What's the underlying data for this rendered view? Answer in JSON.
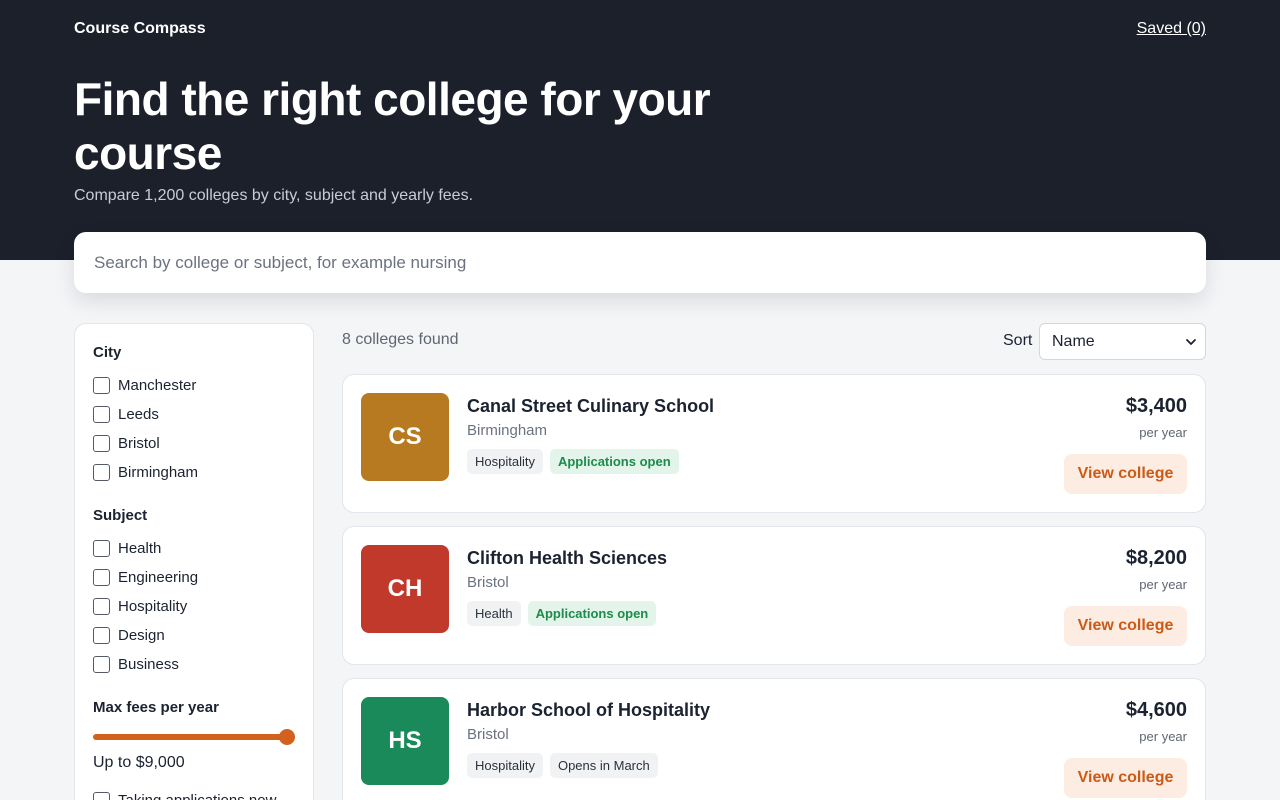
{
  "header": {
    "brand": "Course Compass",
    "saved_link": "Saved (0)",
    "title": "Find the right college for your course",
    "subtitle": "Compare 1,200 colleges by city, subject and yearly fees."
  },
  "search": {
    "placeholder": "Search by college or subject, for example nursing",
    "value": ""
  },
  "filters": {
    "city": {
      "heading": "City",
      "options": [
        {
          "label": "Manchester",
          "checked": false
        },
        {
          "label": "Leeds",
          "checked": false
        },
        {
          "label": "Bristol",
          "checked": false
        },
        {
          "label": "Birmingham",
          "checked": false
        }
      ]
    },
    "subject": {
      "heading": "Subject",
      "options": [
        {
          "label": "Health",
          "checked": false
        },
        {
          "label": "Engineering",
          "checked": false
        },
        {
          "label": "Hospitality",
          "checked": false
        },
        {
          "label": "Design",
          "checked": false
        },
        {
          "label": "Business",
          "checked": false
        }
      ]
    },
    "fees": {
      "heading": "Max fees per year",
      "value_label": "Up to $9,000",
      "fraction": 1.0
    },
    "applications_now": {
      "label": "Taking applications now",
      "checked": false
    }
  },
  "results": {
    "count_label": "8 colleges found",
    "sort_label": "Sort",
    "sort_value": "Name"
  },
  "colleges": [
    {
      "initials": "CS",
      "logo_color": "#b87a20",
      "name": "Canal Street Culinary School",
      "city": "Birmingham",
      "tags": [
        {
          "text": "Hospitality",
          "kind": "subject"
        },
        {
          "text": "Applications open",
          "kind": "open"
        }
      ],
      "price": "$3,400",
      "per": "per year",
      "button": "View college"
    },
    {
      "initials": "CH",
      "logo_color": "#c0392b",
      "name": "Clifton Health Sciences",
      "city": "Bristol",
      "tags": [
        {
          "text": "Health",
          "kind": "subject"
        },
        {
          "text": "Applications open",
          "kind": "open"
        }
      ],
      "price": "$8,200",
      "per": "per year",
      "button": "View college"
    },
    {
      "initials": "HS",
      "logo_color": "#1a8a5a",
      "name": "Harbor School of Hospitality",
      "city": "Bristol",
      "tags": [
        {
          "text": "Hospitality",
          "kind": "subject"
        },
        {
          "text": "Opens in March",
          "kind": "status"
        }
      ],
      "price": "$4,600",
      "per": "per year",
      "button": "View college"
    }
  ],
  "colors": {
    "hero_bg": "#1b202b",
    "accent": "#d2611f",
    "accent_soft": "#fdece1",
    "open_green": "#1d8b4b"
  }
}
